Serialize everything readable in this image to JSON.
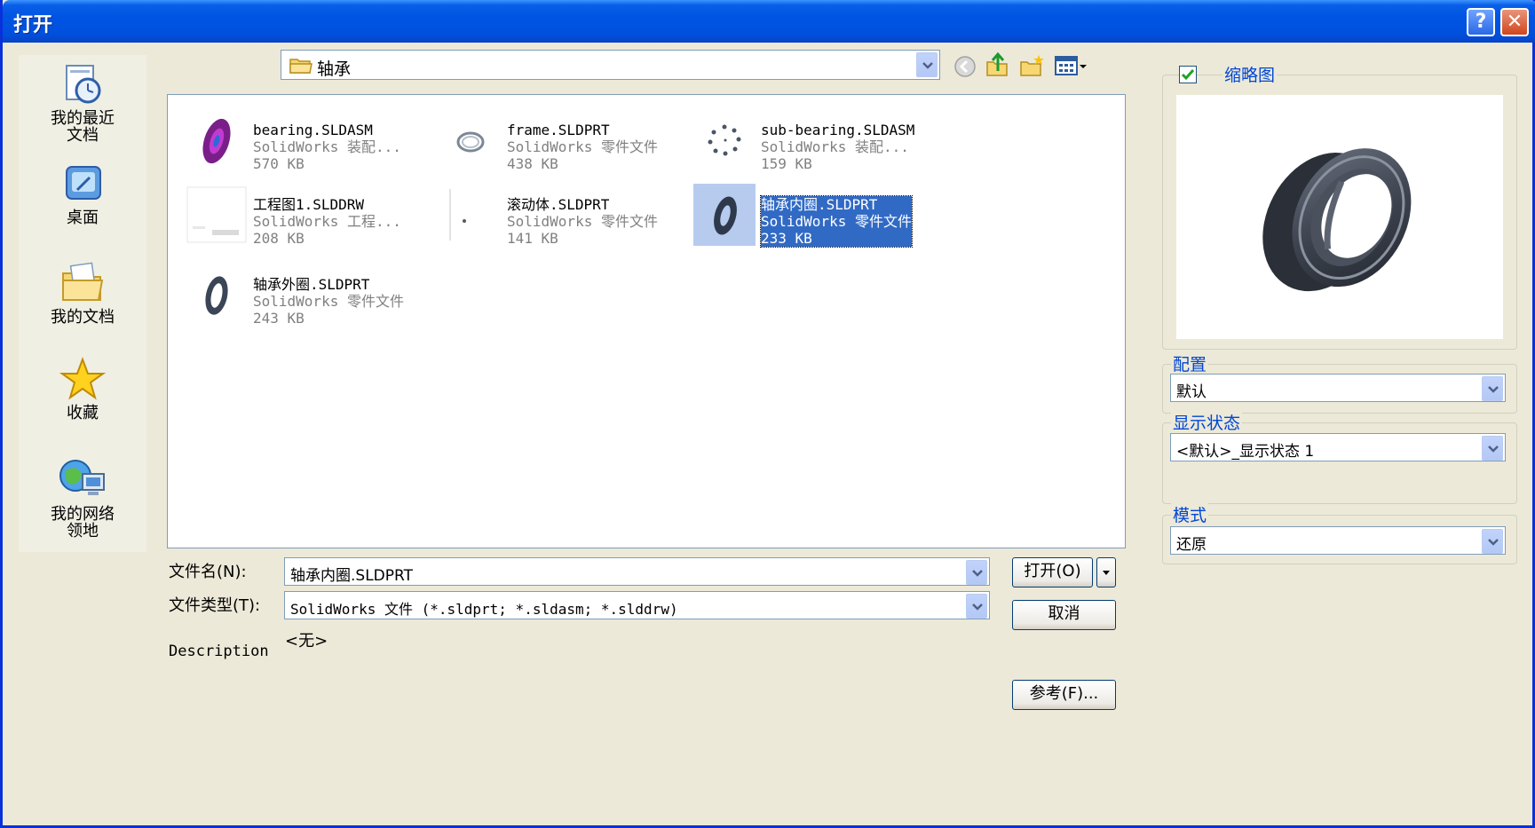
{
  "window": {
    "title": "打开"
  },
  "places": [
    {
      "label_line1": "我的最近",
      "label_line2": "文档",
      "icon": "recent-documents-icon"
    },
    {
      "label_line1": "桌面",
      "label_line2": "",
      "icon": "desktop-icon"
    },
    {
      "label_line1": "我的文档",
      "label_line2": "",
      "icon": "my-documents-icon"
    },
    {
      "label_line1": "收藏",
      "label_line2": "",
      "icon": "favorites-star-icon"
    },
    {
      "label_line1": "我的网络",
      "label_line2": "领地",
      "icon": "network-places-icon"
    }
  ],
  "toolbar": {
    "look_in": "轴承",
    "icons": [
      "back-icon",
      "up-folder-icon",
      "new-folder-icon",
      "views-menu-icon"
    ]
  },
  "files": [
    {
      "name": "bearing.SLDASM",
      "type": "SolidWorks 装配...",
      "size": "570 KB",
      "selected": false
    },
    {
      "name": "frame.SLDPRT",
      "type": "SolidWorks 零件文件",
      "size": "438 KB",
      "selected": false
    },
    {
      "name": "sub-bearing.SLDASM",
      "type": "SolidWorks 装配...",
      "size": "159 KB",
      "selected": false
    },
    {
      "name": "工程图1.SLDDRW",
      "type": "SolidWorks 工程...",
      "size": "208 KB",
      "selected": false
    },
    {
      "name": "滚动体.SLDPRT",
      "type": "SolidWorks 零件文件",
      "size": "141 KB",
      "selected": false
    },
    {
      "name": "轴承内圈.SLDPRT",
      "type": "SolidWorks 零件文件",
      "size": "233 KB",
      "selected": true
    },
    {
      "name": "轴承外圈.SLDPRT",
      "type": "SolidWorks 零件文件",
      "size": "243 KB",
      "selected": false
    }
  ],
  "form": {
    "filename_label": "文件名(N):",
    "filename_value": "轴承内圈.SLDPRT",
    "filetype_label": "文件类型(T):",
    "filetype_value": "SolidWorks 文件 (*.sldprt; *.sldasm; *.slddrw)",
    "description_label": "Description",
    "description_value": "<无>"
  },
  "buttons": {
    "open": "打开(O)",
    "cancel": "取消",
    "references": "参考(F)..."
  },
  "panel": {
    "thumbnail_label": "缩略图",
    "thumbnail_checked": true,
    "config_label": "配置",
    "config_value": "默认",
    "display_state_label": "显示状态",
    "display_state_value": "<默认>_显示状态 1",
    "mode_label": "模式",
    "mode_value": "还原"
  },
  "colors": {
    "titlebar": "#0054E3",
    "dialog_bg": "#ECE9D8",
    "selection": "#316AC5",
    "group_label": "#0046D5"
  }
}
